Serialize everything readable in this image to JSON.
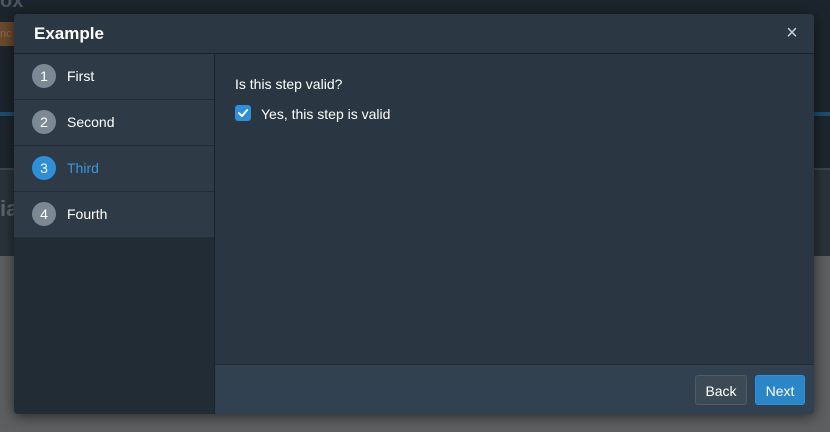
{
  "background": {
    "title_fragment": "ox",
    "tag_fragment": "nc",
    "band_fragment": "ia"
  },
  "modal": {
    "title": "Example",
    "close_glyph": "×",
    "steps": [
      {
        "number": "1",
        "label": "First",
        "active": false
      },
      {
        "number": "2",
        "label": "Second",
        "active": false
      },
      {
        "number": "3",
        "label": "Third",
        "active": true
      },
      {
        "number": "4",
        "label": "Fourth",
        "active": false
      }
    ],
    "content": {
      "question": "Is this step valid?",
      "checkbox_label": "Yes, this step is valid",
      "checkbox_checked": true
    },
    "footer": {
      "back_label": "Back",
      "next_label": "Next"
    }
  },
  "colors": {
    "accent": "#2e8fd6",
    "active_text": "#3a97df"
  },
  "icons": {
    "close": "close-icon",
    "check": "check-icon"
  }
}
